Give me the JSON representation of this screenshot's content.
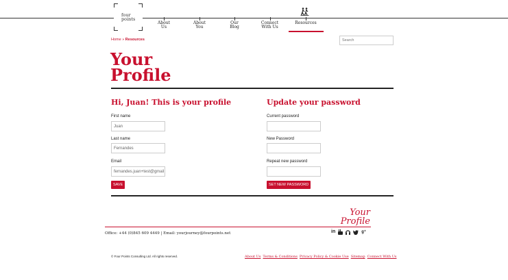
{
  "header": {
    "logo_line1": "four",
    "logo_line2": "points",
    "nav": [
      {
        "line1": "About",
        "line2": "Us"
      },
      {
        "line1": "About",
        "line2": "You"
      },
      {
        "line1": "Our",
        "line2": "Blog"
      },
      {
        "line1": "Connect",
        "line2": "With Us"
      },
      {
        "line1": "Resources",
        "line2": ""
      }
    ],
    "search_placeholder": "Search"
  },
  "breadcrumb": {
    "home": "Home",
    "separator": "»",
    "current": "Resources"
  },
  "page": {
    "title_line1": "Your",
    "title_line2": "Profile"
  },
  "profile_form": {
    "title": "Hi, Juan! This is your profile",
    "first_name_label": "First name",
    "first_name_value": "Juan",
    "last_name_label": "Last name",
    "last_name_value": "Fernandes",
    "email_label": "Email",
    "email_value": "fernandes.juan+test@gmail",
    "save_label": "SAVE"
  },
  "password_form": {
    "title": "Update your password",
    "current_label": "Current password",
    "new_label": "New Password",
    "repeat_label": "Repeat new password",
    "submit_label": "SET NEW PASSWORD"
  },
  "footer": {
    "title_line1": "Your",
    "title_line2": "Profile",
    "office": "Office: +44 (0)845 609 4449 | Email: yourjourney@fourpoints.net",
    "social_icons": [
      "linkedin-icon",
      "youtube-icon",
      "podcast-icon",
      "twitter-icon",
      "google-plus-icon"
    ],
    "copyright": "© Four Points Consulting Ltd. All rights reserved.",
    "links": [
      "About Us",
      "Terms & Conditions",
      "Privacy Policy & Cookie Use",
      "Sitemap",
      "Connect With Us"
    ]
  },
  "colors": {
    "accent": "#c8102e",
    "text": "#222222",
    "border": "#cccccc"
  }
}
